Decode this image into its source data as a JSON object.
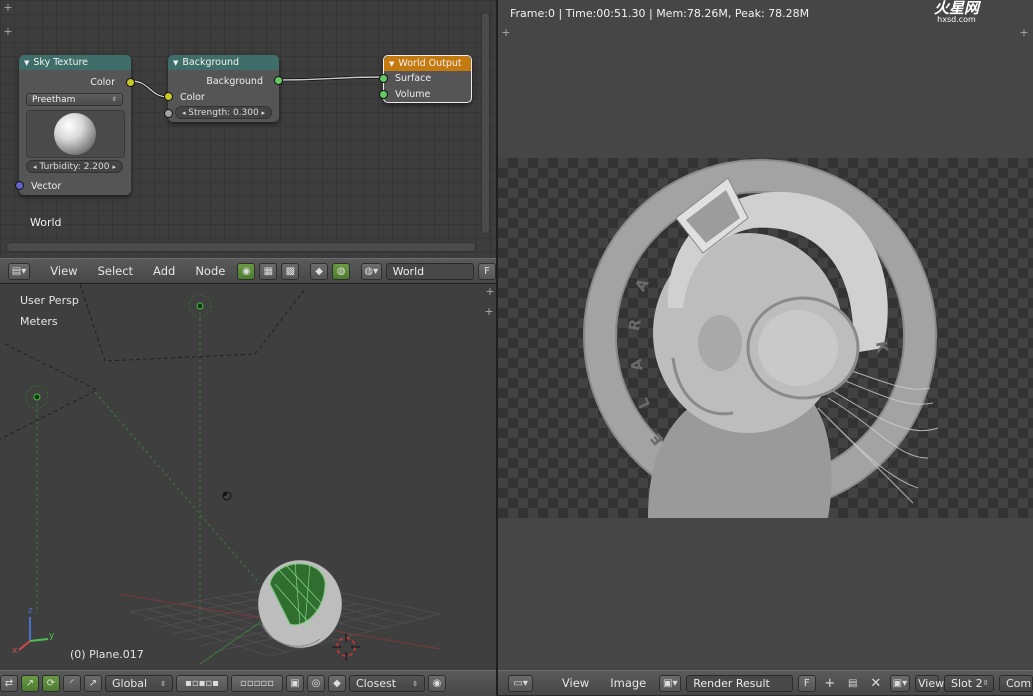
{
  "node_editor": {
    "world_label": "World",
    "nodes": {
      "sky_texture": {
        "title": "Sky Texture",
        "output_color": "Color",
        "model": "Preetham",
        "turbidity_label": "Turbidity:",
        "turbidity_value": "2.200",
        "input_vector": "Vector"
      },
      "background": {
        "title": "Background",
        "output_background": "Background",
        "input_color": "Color",
        "strength_label": "Strength:",
        "strength_value": "0.300"
      },
      "world_output": {
        "title": "World Output",
        "input_surface": "Surface",
        "input_volume": "Volume"
      }
    },
    "header": {
      "menu": [
        "View",
        "Select",
        "Add",
        "Node"
      ],
      "world_field": "World",
      "fake_user": "F"
    }
  },
  "viewport": {
    "view_label": "User Persp",
    "units_label": "Meters",
    "object_label": "(0) Plane.017",
    "axes": {
      "x": "x",
      "y": "y",
      "z": "z"
    },
    "header": {
      "orientation": "Global",
      "snap": "Closest"
    }
  },
  "image_editor": {
    "stats": "Frame:0 | Time:00:51.30 | Mem:78.26M, Peak: 78.28M",
    "logo": "火星网",
    "logo_sub": "hxsd.com",
    "render_letters": [
      "A",
      "R",
      "A",
      "L",
      "E",
      "K"
    ],
    "header": {
      "menu": [
        "View",
        "Image"
      ],
      "image_name": "Render Result",
      "fake_user": "F",
      "view_label": "View",
      "slot": "Slot 2",
      "composite": "Com"
    }
  },
  "colors": {
    "sky_header": "#3f6e6a",
    "output_header": "#c57a10",
    "socket_yellow": "#c7c729",
    "socket_green": "#63c763",
    "socket_blue": "#6363c7",
    "wire_color": "#dddddd"
  }
}
